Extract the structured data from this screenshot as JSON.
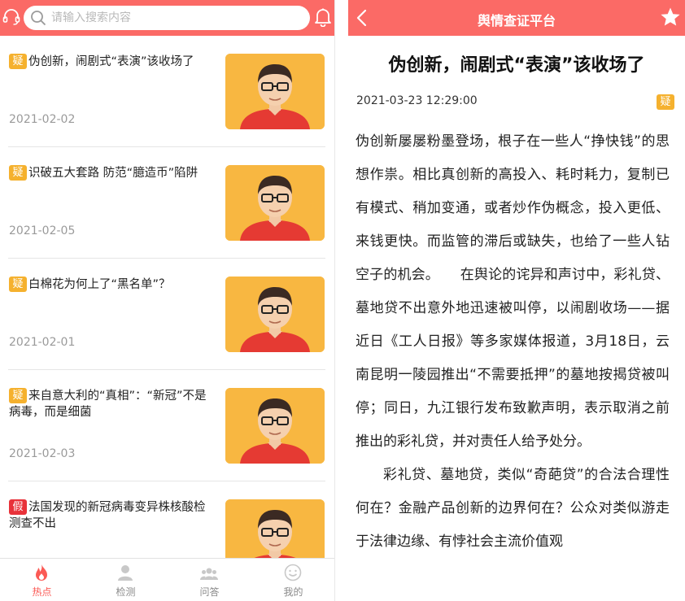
{
  "left": {
    "search": {
      "placeholder": "请输入搜索内容"
    },
    "items": [
      {
        "badge": "疑",
        "title": "伪创新，闹剧式“表演”该收场了",
        "date": "2021-02-02"
      },
      {
        "badge": "疑",
        "title": "识破五大套路 防范“臆造币”陷阱",
        "date": "2021-02-05"
      },
      {
        "badge": "疑",
        "title": "白棉花为何上了“黑名单”？",
        "date": "2021-02-01"
      },
      {
        "badge": "疑",
        "title": "来自意大利的“真相”：“新冠”不是病毒，而是细菌",
        "date": "2021-02-03"
      },
      {
        "badge": "假",
        "title": "法国发现的新冠病毒变异株核酸检测查不出",
        "date": ""
      }
    ],
    "tabs": [
      {
        "label": "热点",
        "icon": "fire-icon",
        "active": true
      },
      {
        "label": "检测",
        "icon": "user-check-icon",
        "active": false
      },
      {
        "label": "问答",
        "icon": "group-icon",
        "active": false
      },
      {
        "label": "我的",
        "icon": "smile-icon",
        "active": false
      }
    ]
  },
  "right": {
    "header_title": "舆情查证平台",
    "article": {
      "title": "伪创新，闹剧式“表演”该收场了",
      "time": "2021-03-23 12:29:00",
      "badge": "疑",
      "paragraphs": [
        "伪创新屡屡粉墨登场，根子在一些人“挣快钱”的思想作祟。相比真创新的高投入、耗时耗力，复制已有模式、稍加变通，或者炒作伪概念，投入更低、来钱更快。而监管的滞后或缺失，也给了一些人钻空子的机会。　　在舆论的诧异和声讨中，彩礼贷、墓地贷不出意外地迅速被叫停，以闹剧收场——据近日《工人日报》等多家媒体报道，3月18日，云南昆明一陵园推出“不需要抵押”的墓地按揭贷被叫停；同日，九江银行发布致歉声明，表示取消之前推出的彩礼贷，并对责任人给予处分。",
        "彩礼贷、墓地贷，类似“奇葩贷”的合法合理性何在？金融产品创新的边界何在？公众对类似游走于法律边缘、有悖社会主流价值观"
      ]
    }
  },
  "colors": {
    "brand": "#fb6a66",
    "doubt_badge": "#f5b12e",
    "fake_badge": "#e8323a",
    "active_tab": "#fb5a55"
  }
}
